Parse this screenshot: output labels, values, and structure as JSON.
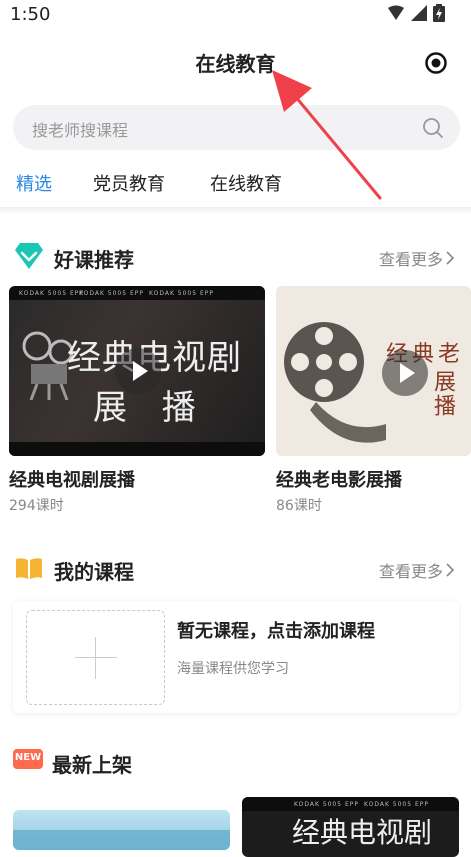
{
  "status_bar": {
    "time": "1:50"
  },
  "header": {
    "title": "在线教育"
  },
  "search": {
    "placeholder": "搜老师搜课程"
  },
  "tabs": [
    {
      "label": "精选",
      "active": true
    },
    {
      "label": "党员教育",
      "active": false
    },
    {
      "label": "在线教育",
      "active": false
    }
  ],
  "recommended": {
    "title": "好课推荐",
    "more": "查看更多",
    "courses": [
      {
        "name": "经典电视剧展播",
        "lessons": "294课时",
        "thumb_title_line1": "经典电视剧",
        "thumb_title_line2": "展 播"
      },
      {
        "name": "经典老电影展播",
        "lessons": "86课时",
        "thumb_title_line1": "经典老",
        "thumb_title_line2": "展播"
      }
    ]
  },
  "my_courses": {
    "title": "我的课程",
    "more": "查看更多",
    "empty_title": "暂无课程，点击添加课程",
    "empty_subtitle": "海量课程供您学习"
  },
  "latest": {
    "title": "最新上架",
    "badge": "NEW",
    "thumb_title": "经典电视剧"
  },
  "film_label": "KODAK 5005 EPP",
  "colors": {
    "accent": "#2b86e6",
    "icon_teal": "#19c7b3",
    "icon_yellow": "#f5b533",
    "new_badge": "#ff6a4d",
    "arrow_red": "#f0414a"
  }
}
